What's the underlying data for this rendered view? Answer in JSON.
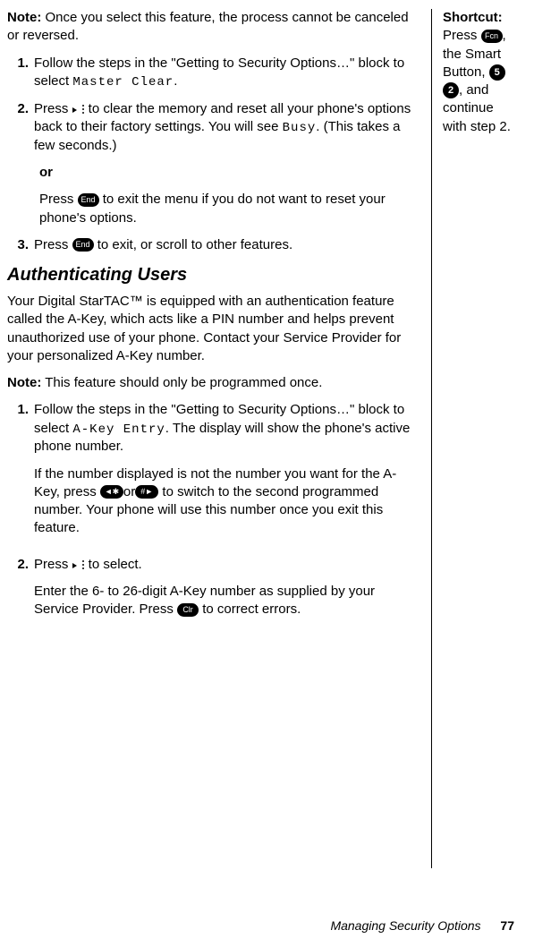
{
  "note1": {
    "label": "Note:",
    "text": " Once you select this feature, the process cannot be canceled or reversed."
  },
  "listA": {
    "i1": {
      "num": "1.",
      "t1": "Follow the steps in the \"Getting to Security Options…\" block to select ",
      "lcd": "Master Clear",
      "t2": "."
    },
    "i2": {
      "num": "2.",
      "t1": "Press ",
      "t2": " to clear the memory and reset all your phone's options back to their factory settings. You will see ",
      "lcd": "Busy",
      "t3": ". (This takes a few seconds.)"
    },
    "orLabel": "or",
    "orBody": {
      "t1": "Press ",
      "t2": " to exit the menu if you do not want to reset your phone's options."
    },
    "i3": {
      "num": "3.",
      "t1": "Press ",
      "t2": " to exit, or scroll to other features."
    }
  },
  "heading": "Authenticating Users",
  "intro": "Your Digital StarTAC™ is equipped with an authentication feature called the A-Key, which acts like a PIN number and helps prevent unauthorized use of your phone. Contact your Service Provider for your personalized A-Key number.",
  "note2": {
    "label": "Note:",
    "text": " This feature should only be programmed once."
  },
  "listB": {
    "i1": {
      "num": "1.",
      "p1a": "Follow the steps in the \"Getting to Security Options…\" block to select ",
      "lcd": "A-Key Entry",
      "p1b": ". The display will show the phone's active phone number.",
      "p2a": "If the number displayed is not the number you want for the A-Key, press ",
      "p2b": "or",
      "p2c": " to switch to the second programmed number. Your phone will use this number once you exit this feature."
    },
    "i2": {
      "num": "2.",
      "p1a": "Press ",
      "p1b": " to select.",
      "p2a": "Enter the 6- to 26-digit A-Key number as supplied by your Service Provider. Press ",
      "p2b": " to correct errors."
    }
  },
  "side": {
    "label": "Shortcut:",
    "t1": "Press ",
    "t2": ", the Smart Button, ",
    "t3": " ",
    "t4": ", and continue with step 2."
  },
  "keys": {
    "fcn": "Fcn",
    "end": "End",
    "clr": "Clr",
    "five": "5",
    "two": "2",
    "star": "◄✱",
    "hash": "#►"
  },
  "footer": {
    "title": "Managing Security Options",
    "page": "77"
  }
}
